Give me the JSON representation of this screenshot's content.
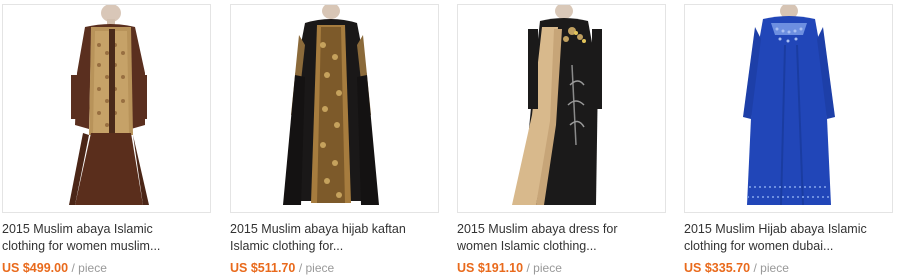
{
  "products": [
    {
      "title_line1": "2015 Muslim abaya Islamic",
      "title_line2": "clothing for women muslim...",
      "price": "US $499.00",
      "unit": "/ piece"
    },
    {
      "title_line1": "2015 Muslim abaya hijab kaftan",
      "title_line2": "Islamic clothing for...",
      "price": "US $511.70",
      "unit": "/ piece"
    },
    {
      "title_line1": "2015 Muslim abaya dress for",
      "title_line2": "women Islamic clothing...",
      "price": "US $191.10",
      "unit": "/ piece"
    },
    {
      "title_line1": "2015 Muslim Hijab abaya Islamic",
      "title_line2": "clothing for women dubai...",
      "price": "US $335.70",
      "unit": "/ piece"
    }
  ],
  "colors": {
    "price": "#e96a1c",
    "unit": "#999999",
    "title": "#333333",
    "border": "#e4e4e4"
  }
}
